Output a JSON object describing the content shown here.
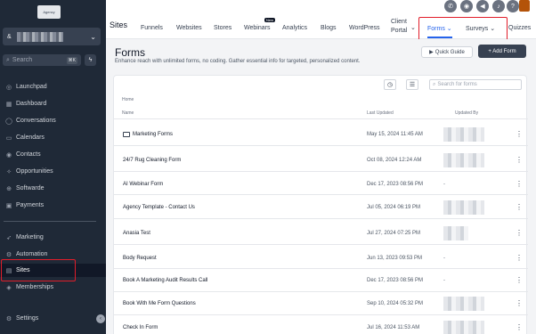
{
  "sidebar": {
    "logo_text": "Agency",
    "account_chevron": "⌄",
    "search_placeholder": "Search",
    "search_shortcut": "⌘K",
    "items": [
      {
        "label": "Launchpad",
        "icon": "rocket-icon",
        "glyph": "◎"
      },
      {
        "label": "Dashboard",
        "icon": "dashboard-icon",
        "glyph": "▦"
      },
      {
        "label": "Conversations",
        "icon": "chat-icon",
        "glyph": "◯"
      },
      {
        "label": "Calendars",
        "icon": "calendar-icon",
        "glyph": "▭"
      },
      {
        "label": "Contacts",
        "icon": "contacts-icon",
        "glyph": "◉"
      },
      {
        "label": "Opportunities",
        "icon": "opportunities-icon",
        "glyph": "✧"
      },
      {
        "label": "Softwarde",
        "icon": "software-icon",
        "glyph": "⊕"
      },
      {
        "label": "Payments",
        "icon": "payments-icon",
        "glyph": "▣"
      },
      {
        "label": "Marketing",
        "icon": "marketing-icon",
        "glyph": "➶"
      },
      {
        "label": "Automation",
        "icon": "automation-icon",
        "glyph": "⚙"
      },
      {
        "label": "Sites",
        "icon": "sites-icon",
        "glyph": "▤"
      },
      {
        "label": "Memberships",
        "icon": "memberships-icon",
        "glyph": "◈"
      },
      {
        "label": "Settings",
        "icon": "settings-icon",
        "glyph": "⚙"
      }
    ]
  },
  "topbar": {
    "section": "Sites",
    "tabs": [
      {
        "label": "Funnels"
      },
      {
        "label": "Websites"
      },
      {
        "label": "Stores"
      },
      {
        "label": "Webinars"
      },
      {
        "label": "Analytics"
      },
      {
        "label": "Blogs"
      },
      {
        "label": "WordPress"
      },
      {
        "label": "Client Portal"
      },
      {
        "label": "Forms"
      },
      {
        "label": "Surveys"
      },
      {
        "label": "Quizzes"
      }
    ],
    "new_badge": "New",
    "chevron": "⌄"
  },
  "content": {
    "title": "Forms",
    "subtitle": "Enhance reach with unlimited forms, no coding. Gather essential info for targeted, personalized content.",
    "secondary_button": "Quick Guide",
    "primary_button": "+ Add Form",
    "search_placeholder": "Search for forms",
    "breadcrumb": "Home",
    "columns": {
      "name": "Name",
      "updated": "Last Updated",
      "updated_by": "Updated By"
    },
    "rows": [
      {
        "name": "Marketing Forms",
        "folder": true,
        "date": "May 15, 2024 11:45 AM",
        "updated_by": ""
      },
      {
        "name": "24/7 Rug Cleaning Form",
        "folder": false,
        "date": "Oct 08, 2024 12:24 AM",
        "updated_by": ""
      },
      {
        "name": "AI Webinar Form",
        "folder": false,
        "date": "Dec 17, 2023 08:56 PM",
        "updated_by": "-"
      },
      {
        "name": "Agency Template - Contact Us",
        "folder": false,
        "date": "Jul 05, 2024 06:19 PM",
        "updated_by": ""
      },
      {
        "name": "Anasia Test",
        "folder": false,
        "date": "Jul 27, 2024 07:25 PM",
        "updated_by": ""
      },
      {
        "name": "Body Request",
        "folder": false,
        "date": "Jun 13, 2023 09:53 PM",
        "updated_by": "-"
      },
      {
        "name": "Book A Marketing Audit Results Call",
        "folder": false,
        "date": "Dec 17, 2023 08:56 PM",
        "updated_by": "-"
      },
      {
        "name": "Book With Me Form Questions",
        "folder": false,
        "date": "Sep 10, 2024 05:32 PM",
        "updated_by": ""
      },
      {
        "name": "Check In Form",
        "folder": false,
        "date": "Jul 16, 2024 11:53 AM",
        "updated_by": ""
      }
    ],
    "more_glyph": "⋮"
  },
  "colors": {
    "sidebar_bg": "#1f2937",
    "accent": "#2563eb",
    "highlight": "#e11d2a"
  }
}
